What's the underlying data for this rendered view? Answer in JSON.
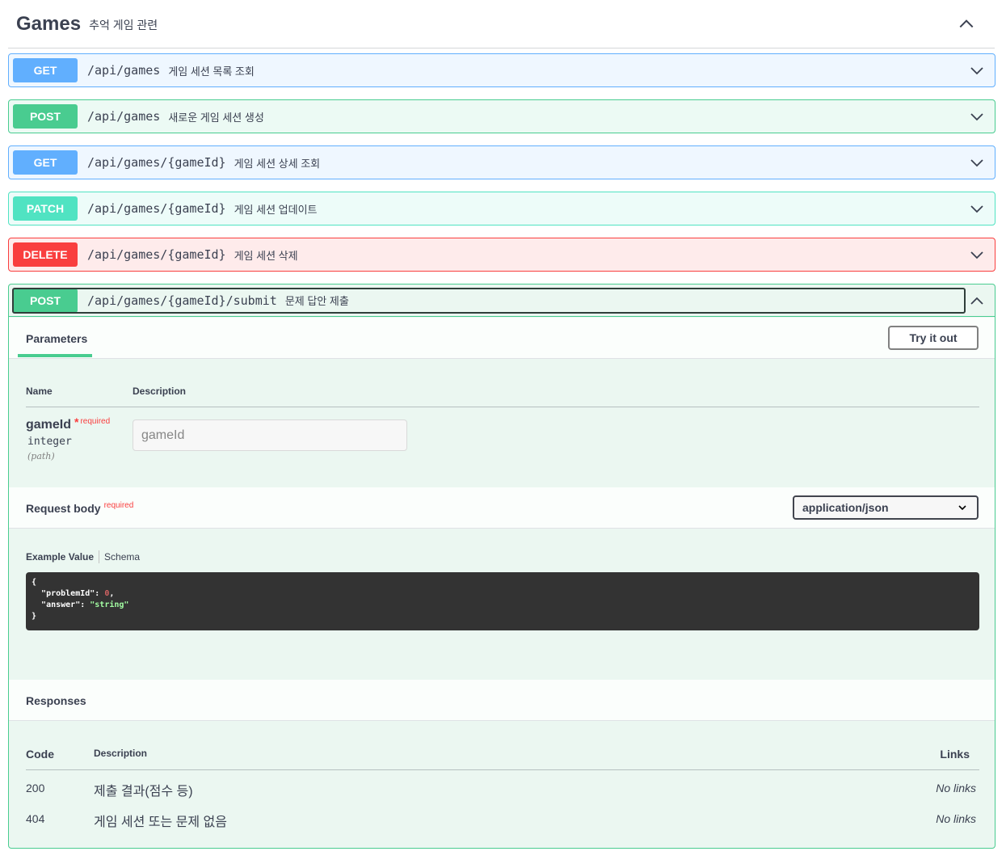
{
  "tag": {
    "title": "Games",
    "description": "추억 게임 관련"
  },
  "operations": [
    {
      "method": "GET",
      "path": "/api/games",
      "summary": "게임 세션 목록 조회"
    },
    {
      "method": "POST",
      "path": "/api/games",
      "summary": "새로운 게임 세션 생성"
    },
    {
      "method": "GET",
      "path": "/api/games/{gameId}",
      "summary": "게임 세션 상세 조회"
    },
    {
      "method": "PATCH",
      "path": "/api/games/{gameId}",
      "summary": "게임 세션 업데이트"
    },
    {
      "method": "DELETE",
      "path": "/api/games/{gameId}",
      "summary": "게임 세션 삭제"
    },
    {
      "method": "POST",
      "path": "/api/games/{gameId}/submit",
      "summary": "문제 답안 제출"
    }
  ],
  "expanded": {
    "parameters_tab": "Parameters",
    "try_it_out": "Try it out",
    "col_name": "Name",
    "col_description": "Description",
    "param": {
      "name": "gameId",
      "star": "*",
      "required": "required",
      "type": "integer",
      "in": "(path)",
      "placeholder": "gameId"
    },
    "request_body": {
      "title": "Request body",
      "required": "required",
      "content_type": "application/json",
      "tab_example": "Example Value",
      "tab_schema": "Schema",
      "example": {
        "open": "{",
        "k1": "\"problemId\"",
        "v1": "0",
        "k2": "\"answer\"",
        "v2": "\"string\"",
        "close": "}"
      }
    },
    "responses": {
      "title": "Responses",
      "col_code": "Code",
      "col_description": "Description",
      "col_links": "Links",
      "rows": [
        {
          "code": "200",
          "description": "제출 결과(점수 등)",
          "links": "No links"
        },
        {
          "code": "404",
          "description": "게임 세션 또는 문제 없음",
          "links": "No links"
        }
      ]
    }
  },
  "colors": {
    "get": "#61affe",
    "post": "#49cc90",
    "patch": "#50e3c2",
    "delete": "#f93e3e"
  }
}
